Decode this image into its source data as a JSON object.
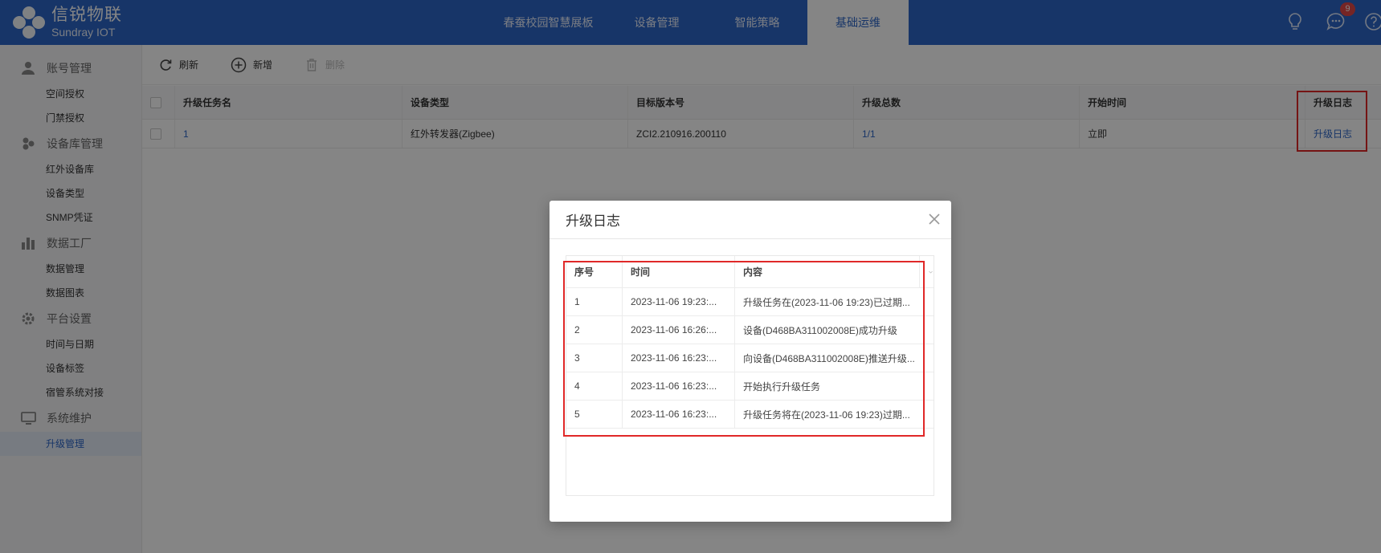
{
  "header": {
    "logo_cn": "信锐物联",
    "logo_en": "Sundray IOT",
    "tabs": [
      {
        "label": "春蚕校园智慧展板"
      },
      {
        "label": "设备管理"
      },
      {
        "label": "智能策略"
      },
      {
        "label": "基础运维"
      }
    ],
    "active_tab": "基础运维",
    "message_badge": "9"
  },
  "sidebar": {
    "groups": [
      {
        "label": "账号管理",
        "icon": "user-icon",
        "items": [
          "空间授权",
          "门禁授权"
        ]
      },
      {
        "label": "设备库管理",
        "icon": "device-library-icon",
        "items": [
          "红外设备库",
          "设备类型",
          "SNMP凭证"
        ]
      },
      {
        "label": "数据工厂",
        "icon": "chart-icon",
        "items": [
          "数据管理",
          "数据图表"
        ]
      },
      {
        "label": "平台设置",
        "icon": "gear-icon",
        "items": [
          "时间与日期",
          "设备标签",
          "宿管系统对接"
        ]
      },
      {
        "label": "系统维护",
        "icon": "monitor-icon",
        "items": [
          "升级管理"
        ]
      }
    ],
    "active_item": "升级管理"
  },
  "toolbar": {
    "refresh": "刷新",
    "add": "新增",
    "delete": "删除"
  },
  "table": {
    "columns": [
      "升级任务名",
      "设备类型",
      "目标版本号",
      "升级总数",
      "开始时间",
      "升级日志"
    ],
    "rows": [
      {
        "name": "1",
        "device_type": "红外转发器(Zigbee)",
        "version": "ZCI2.210916.200110",
        "total": "1/1",
        "start": "立即",
        "log": "升级日志"
      }
    ]
  },
  "modal": {
    "title": "升级日志",
    "columns": [
      "序号",
      "时间",
      "内容"
    ],
    "rows": [
      {
        "no": "1",
        "time": "2023-11-06 19:23:...",
        "content": "升级任务在(2023-11-06 19:23)已过期..."
      },
      {
        "no": "2",
        "time": "2023-11-06 16:26:...",
        "content": "设备(D468BA311002008E)成功升级"
      },
      {
        "no": "3",
        "time": "2023-11-06 16:23:...",
        "content": "向设备(D468BA311002008E)推送升级..."
      },
      {
        "no": "4",
        "time": "2023-11-06 16:23:...",
        "content": "开始执行升级任务"
      },
      {
        "no": "5",
        "time": "2023-11-06 16:23:...",
        "content": "升级任务将在(2023-11-06 19:23)过期..."
      }
    ]
  }
}
